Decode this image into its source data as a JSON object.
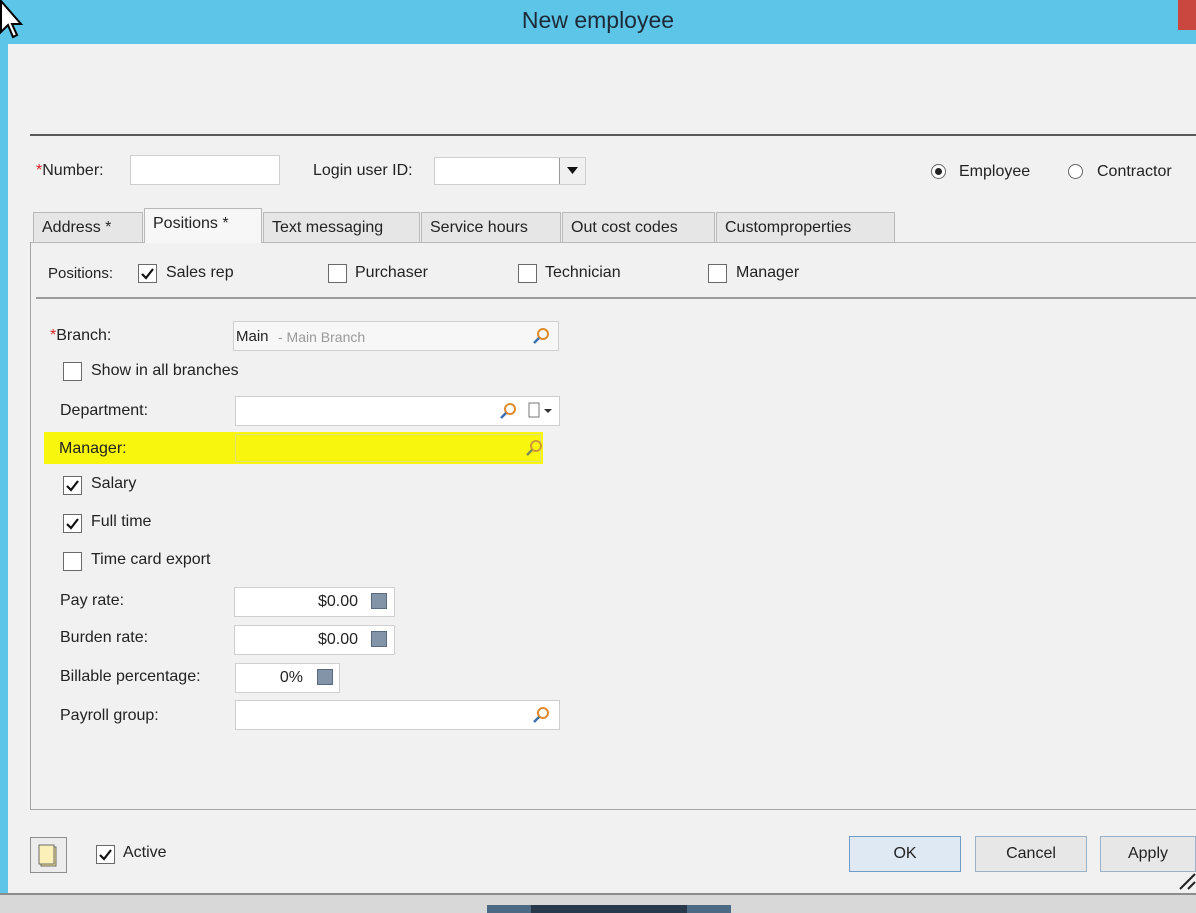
{
  "window": {
    "title": "New employee"
  },
  "header": {
    "number_label": "Number:",
    "number_value": "",
    "login_label": "Login user ID:",
    "login_value": "",
    "type_options": [
      {
        "label": "Employee",
        "selected": true
      },
      {
        "label": "Contractor",
        "selected": false
      }
    ]
  },
  "tabs": [
    {
      "label": "Address *",
      "active": false
    },
    {
      "label": "Positions *",
      "active": true
    },
    {
      "label": "Text messaging",
      "active": false
    },
    {
      "label": "Service hours",
      "active": false
    },
    {
      "label": "Out cost codes",
      "active": false
    },
    {
      "label": "Customproperties",
      "active": false
    }
  ],
  "positions": {
    "label": "Positions:",
    "items": [
      {
        "label": "Sales rep",
        "checked": true
      },
      {
        "label": "Purchaser",
        "checked": false
      },
      {
        "label": "Technician",
        "checked": false
      },
      {
        "label": "Manager",
        "checked": false
      }
    ]
  },
  "form": {
    "branch_label": "Branch:",
    "branch_code": "Main",
    "branch_desc": "- Main Branch",
    "show_all_branches": {
      "label": "Show in all branches",
      "checked": false
    },
    "department_label": "Department:",
    "department_value": "",
    "manager_label": "Manager:",
    "manager_value": "",
    "salary": {
      "label": "Salary",
      "checked": true
    },
    "full_time": {
      "label": "Full time",
      "checked": true
    },
    "time_card_export": {
      "label": "Time card export",
      "checked": false
    },
    "pay_rate_label": "Pay rate:",
    "pay_rate_value": "$0.00",
    "burden_rate_label": "Burden rate:",
    "burden_rate_value": "$0.00",
    "billable_label": "Billable percentage:",
    "billable_value": "0%",
    "payroll_label": "Payroll group:",
    "payroll_value": ""
  },
  "footer": {
    "active": {
      "label": "Active",
      "checked": true
    },
    "ok_label": "OK",
    "cancel_label": "Cancel",
    "apply_label": "Apply"
  },
  "colors": {
    "titlebar": "#5cc5e8",
    "highlight": "#f9f60e",
    "required": "#dd2222"
  }
}
